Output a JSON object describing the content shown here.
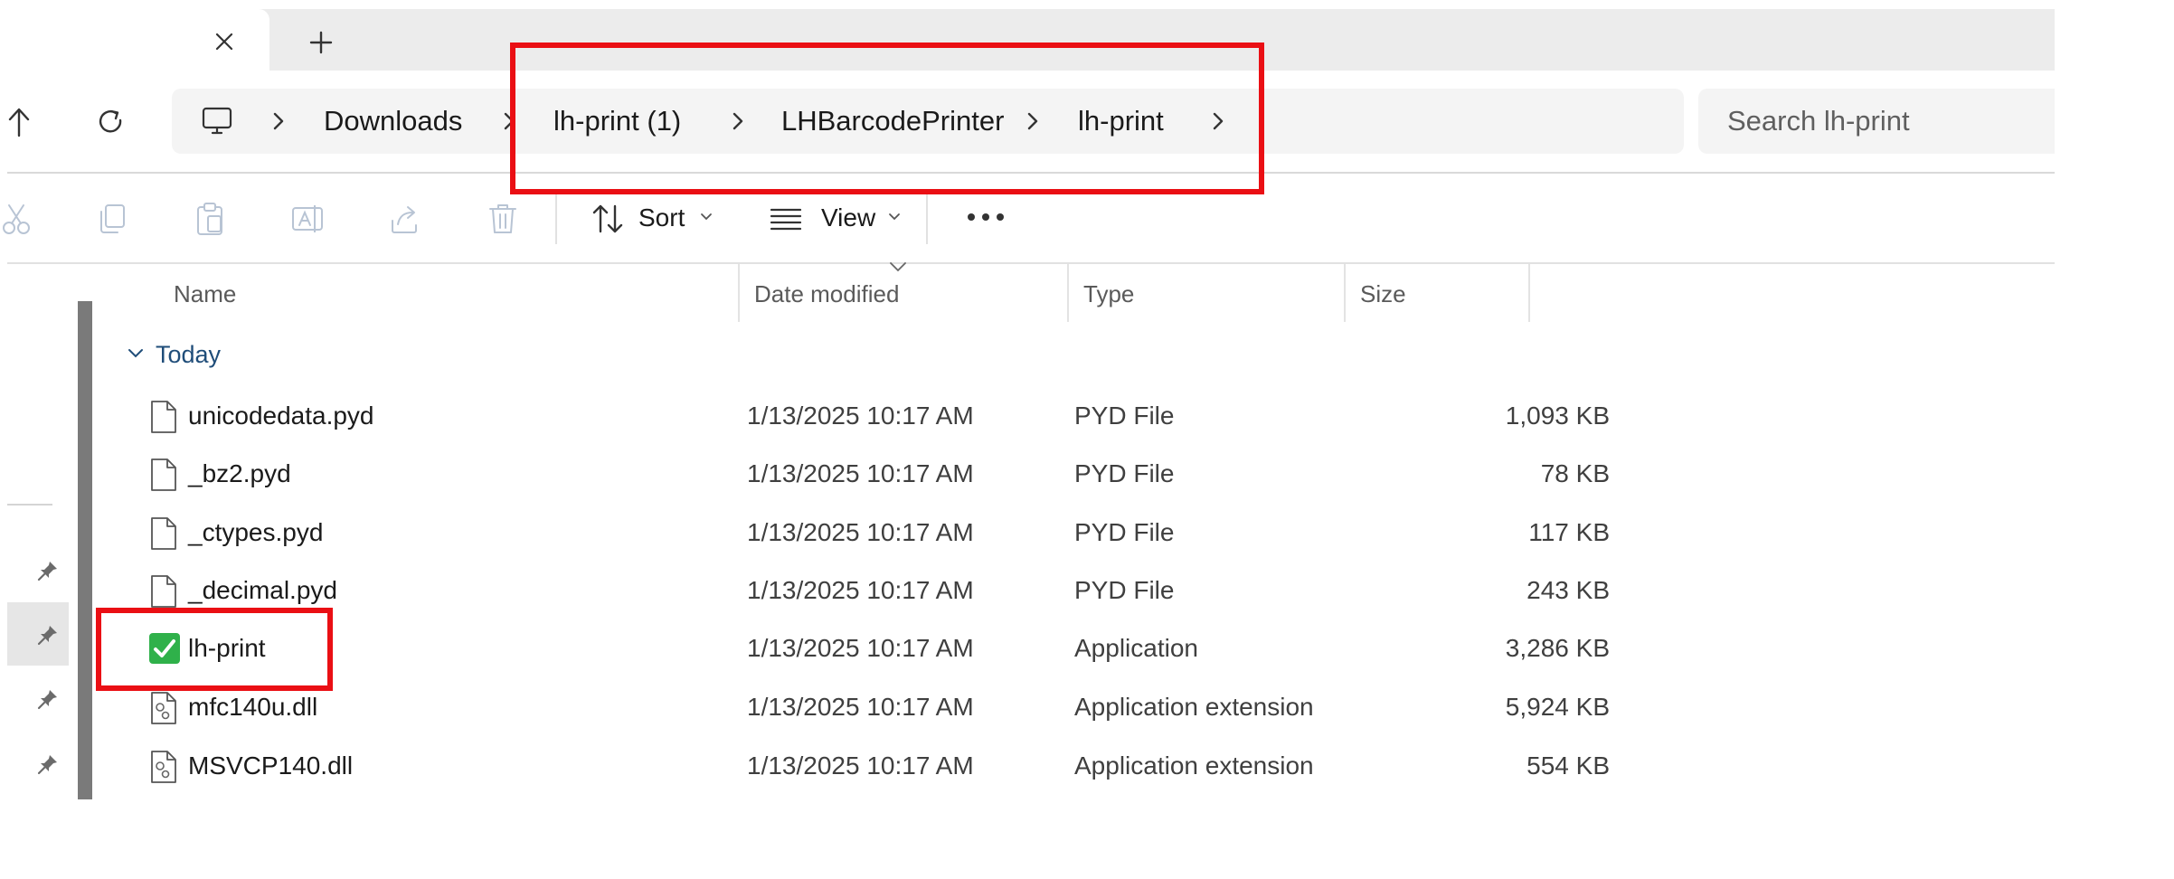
{
  "window": {
    "tab_close_icon": "close-icon",
    "new_tab_icon": "plus-icon"
  },
  "navigation": {
    "up_icon": "arrow-up-icon",
    "refresh_icon": "refresh-icon",
    "root_icon": "this-pc-icon",
    "breadcrumbs": [
      "Downloads",
      "lh-print (1)",
      "LHBarcodePrinter",
      "lh-print"
    ],
    "search_placeholder": "Search lh-print"
  },
  "command_bar": {
    "icons": [
      "cut-icon",
      "copy-icon",
      "paste-icon",
      "rename-icon",
      "share-icon",
      "delete-icon"
    ],
    "sort_label": "Sort",
    "view_label": "View",
    "more_icon": "more-icon"
  },
  "file_list": {
    "columns": [
      "Name",
      "Date modified",
      "Type",
      "Size"
    ],
    "group_label": "Today",
    "rows": [
      {
        "name": "unicodedata.pyd",
        "date": "1/13/2025 10:17 AM",
        "type": "PYD File",
        "size": "1,093 KB",
        "icon": "file-icon"
      },
      {
        "name": "_bz2.pyd",
        "date": "1/13/2025 10:17 AM",
        "type": "PYD File",
        "size": "78 KB",
        "icon": "file-icon"
      },
      {
        "name": "_ctypes.pyd",
        "date": "1/13/2025 10:17 AM",
        "type": "PYD File",
        "size": "117 KB",
        "icon": "file-icon"
      },
      {
        "name": "_decimal.pyd",
        "date": "1/13/2025 10:17 AM",
        "type": "PYD File",
        "size": "243 KB",
        "icon": "file-icon"
      },
      {
        "name": "lh-print",
        "date": "1/13/2025 10:17 AM",
        "type": "Application",
        "size": "3,286 KB",
        "icon": "app-check-icon"
      },
      {
        "name": "mfc140u.dll",
        "date": "1/13/2025 10:17 AM",
        "type": "Application extension",
        "size": "5,924 KB",
        "icon": "dll-file-icon"
      },
      {
        "name": "MSVCP140.dll",
        "date": "1/13/2025 10:17 AM",
        "type": "Application extension",
        "size": "554 KB",
        "icon": "dll-file-icon"
      }
    ]
  },
  "colors": {
    "highlight": "#ea0f14",
    "group_text": "#1f4d79",
    "app_icon_green": "#2fb14a"
  }
}
